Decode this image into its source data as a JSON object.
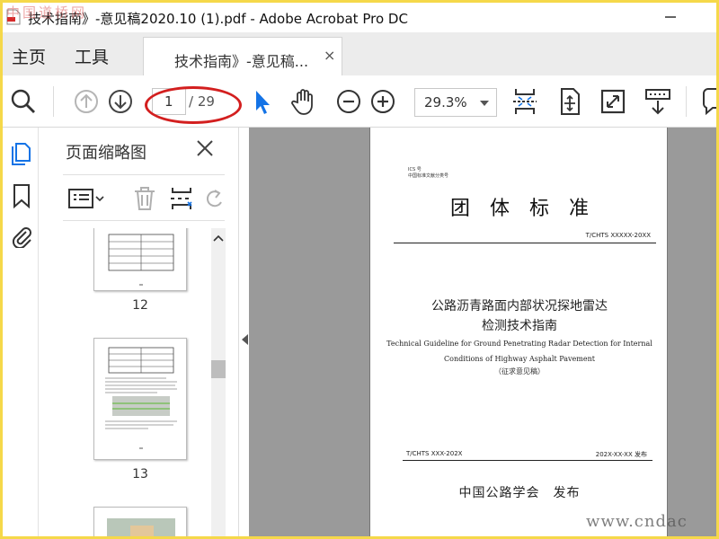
{
  "window": {
    "title": "技术指南》-意见稿2020.10 (1).pdf - Adobe Acrobat Pro DC"
  },
  "watermarks": {
    "top_left": "中国道桥网",
    "bottom_right": "www.cndac"
  },
  "nav": {
    "home": "主页",
    "tools": "工具"
  },
  "tab": {
    "label": "技术指南》-意见稿...",
    "close": "×"
  },
  "toolbar": {
    "current_page": "1",
    "total_pages": "/ 29",
    "zoom": "29.3%",
    "highlight_color": "#d31f1f"
  },
  "panel": {
    "title": "页面缩略图",
    "thumbnails": [
      {
        "page_label": "12"
      },
      {
        "page_label": "13"
      }
    ]
  },
  "document": {
    "ics": "ICS 号",
    "classification": "中国标准文献分类号",
    "heading": "团体标准",
    "code": "T/CHTS XXXXX-20XX",
    "title_line1": "公路沥青路面内部状况探地雷达",
    "title_line2": "检测技术指南",
    "en_line1": "Technical Guideline for Ground Penetrating Radar Detection for Internal",
    "en_line2": "Conditions of Highway Asphalt Pavement",
    "draft": "（征求意见稿）",
    "issue_left": "T/CHTS XXX-202X",
    "issue_right": "202X-XX-XX 发布",
    "publisher": "中国公路学会　发布"
  },
  "colors": {
    "accent": "#1473e6",
    "frame": "#f5d84a"
  }
}
